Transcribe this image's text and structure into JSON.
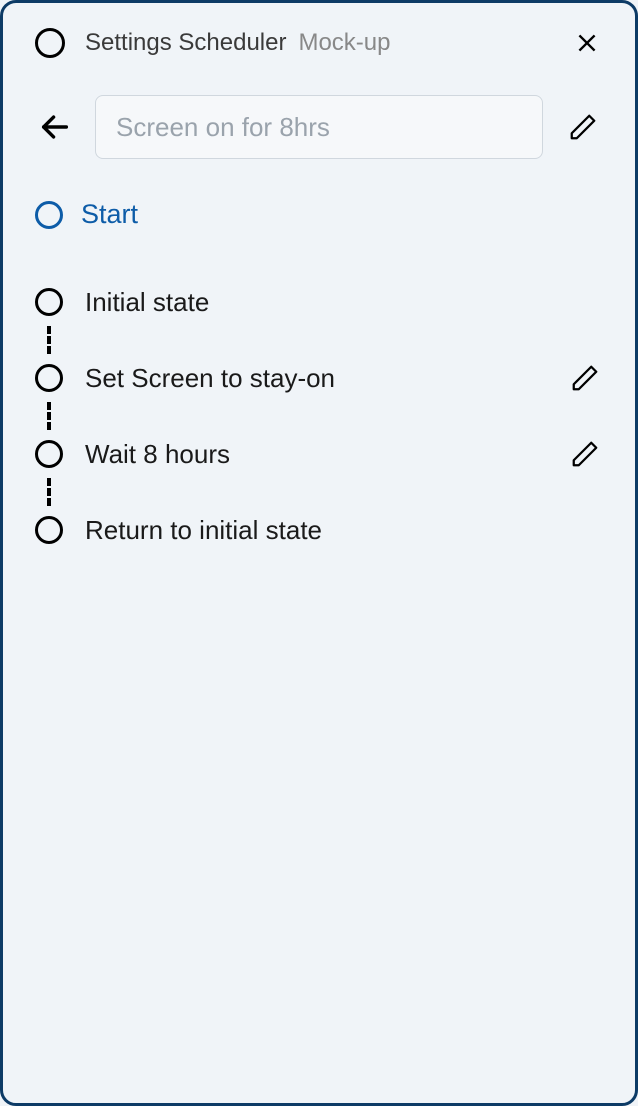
{
  "title": {
    "main": "Settings Scheduler",
    "suffix": "Mock-up"
  },
  "input": {
    "placeholder": "Screen on for 8hrs",
    "value": ""
  },
  "start_label": "Start",
  "steps": [
    {
      "label": "Initial state",
      "editable": false
    },
    {
      "label": "Set Screen to stay-on",
      "editable": true
    },
    {
      "label": "Wait 8 hours",
      "editable": true
    },
    {
      "label": "Return to initial state",
      "editable": false
    }
  ]
}
